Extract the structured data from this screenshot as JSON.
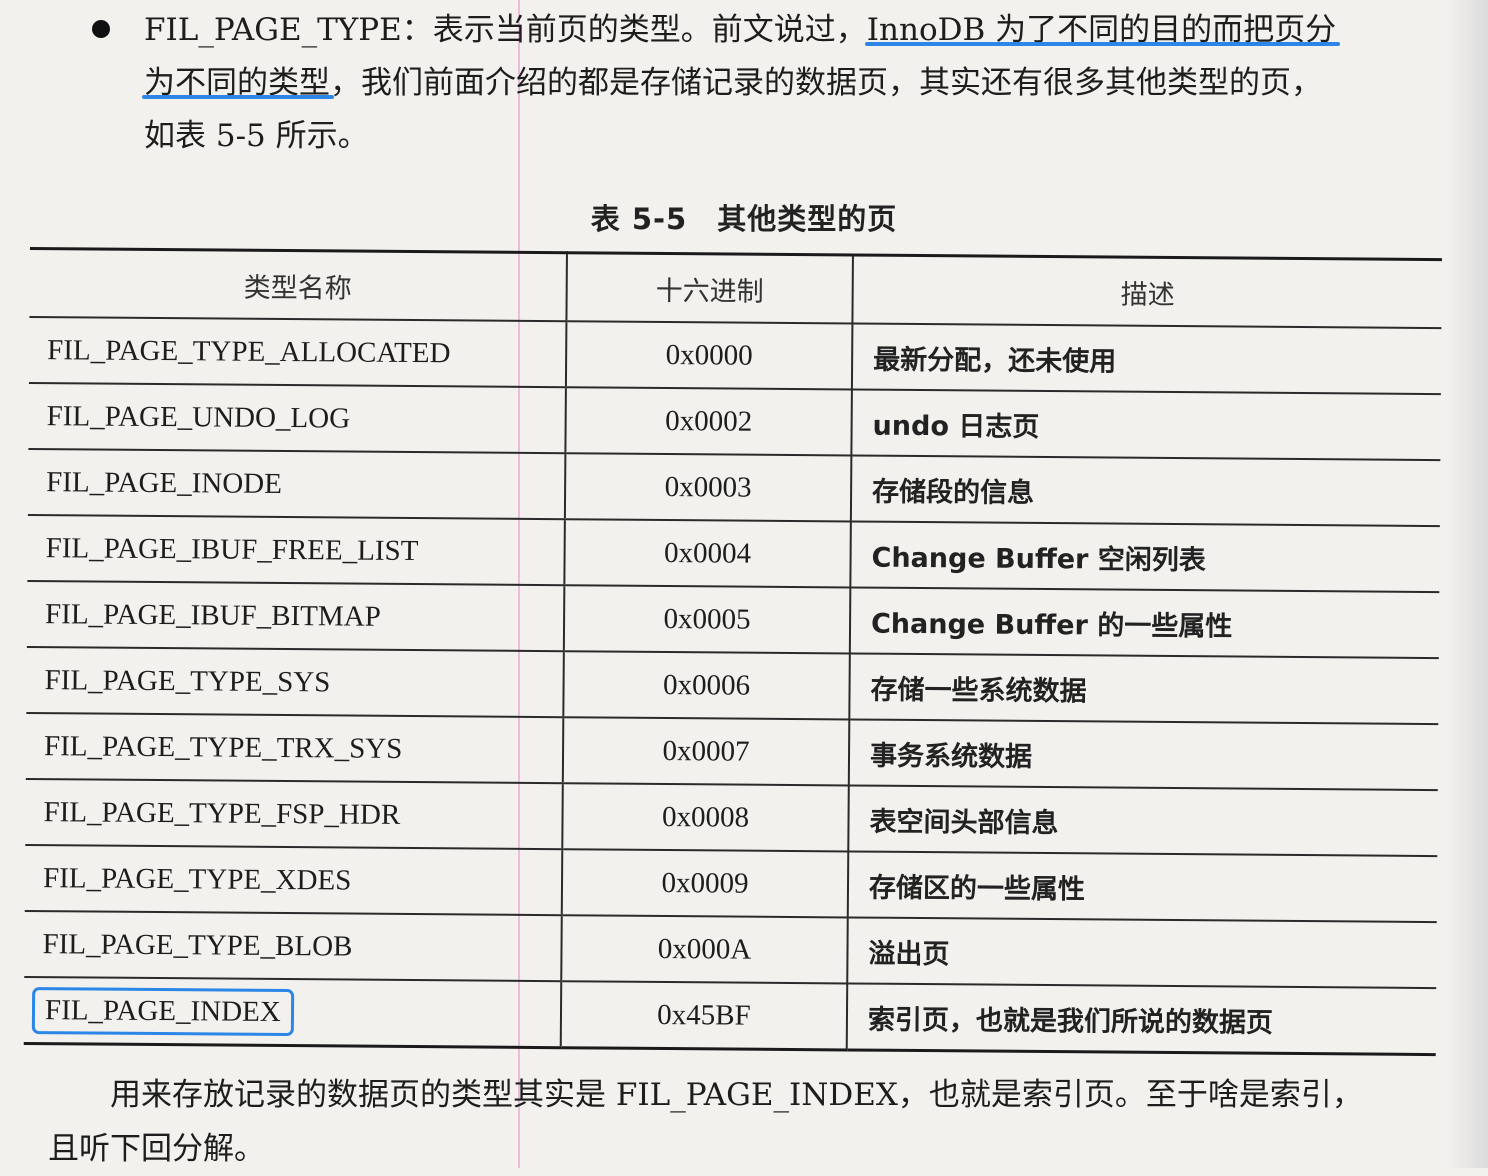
{
  "intro": {
    "line1_before": "FIL_PAGE_TYPE：表示当前页的类型。前文说过，",
    "line1_highlight": "InnoDB 为了不同的目的而把页分",
    "line2_highlight": "为不同的类型",
    "line2_after": "，我们前面介绍的都是存储记录的数据页，其实还有很多其他类型的页，",
    "line3": "如表 5-5 所示。"
  },
  "caption": {
    "number": "表 5-5",
    "title": "其他类型的页"
  },
  "table": {
    "headers": [
      "类型名称",
      "十六进制",
      "描述"
    ],
    "rows": [
      {
        "name": "FIL_PAGE_TYPE_ALLOCATED",
        "hex": "0x0000",
        "desc": "最新分配，还未使用"
      },
      {
        "name": "FIL_PAGE_UNDO_LOG",
        "hex": "0x0002",
        "desc": "undo 日志页"
      },
      {
        "name": "FIL_PAGE_INODE",
        "hex": "0x0003",
        "desc": "存储段的信息"
      },
      {
        "name": "FIL_PAGE_IBUF_FREE_LIST",
        "hex": "0x0004",
        "desc": "Change Buffer 空闲列表"
      },
      {
        "name": "FIL_PAGE_IBUF_BITMAP",
        "hex": "0x0005",
        "desc": "Change Buffer 的一些属性"
      },
      {
        "name": "FIL_PAGE_TYPE_SYS",
        "hex": "0x0006",
        "desc": "存储一些系统数据"
      },
      {
        "name": "FIL_PAGE_TYPE_TRX_SYS",
        "hex": "0x0007",
        "desc": "事务系统数据"
      },
      {
        "name": "FIL_PAGE_TYPE_FSP_HDR",
        "hex": "0x0008",
        "desc": "表空间头部信息"
      },
      {
        "name": "FIL_PAGE_TYPE_XDES",
        "hex": "0x0009",
        "desc": "存储区的一些属性"
      },
      {
        "name": "FIL_PAGE_TYPE_BLOB",
        "hex": "0x000A",
        "desc": "溢出页"
      },
      {
        "name": "FIL_PAGE_INDEX",
        "hex": "0x45BF",
        "desc": "索引页，也就是我们所说的数据页"
      }
    ]
  },
  "outro": {
    "line1": "用来存放记录的数据页的类型其实是 FIL_PAGE_INDEX，也就是索引页。至于啥是索引，",
    "line2": "且听下回分解。"
  },
  "colors": {
    "highlight": "#2b86e8",
    "paper": "#f2f1ee",
    "ink": "#1d1d1d"
  }
}
